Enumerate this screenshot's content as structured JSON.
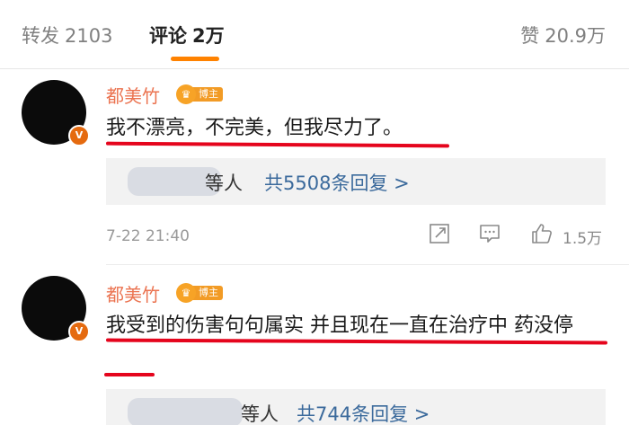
{
  "tabs": {
    "repost_label": "转发",
    "repost_count": "2103",
    "comment_label": "评论",
    "comment_count": "2万",
    "like_label": "赞",
    "like_count": "20.9万"
  },
  "colors": {
    "accent": "#ff8200",
    "username": "#eb7350",
    "link": "#3b6a9c",
    "annotation": "#e5051d"
  },
  "comments": [
    {
      "username": "都美竹",
      "badge_label": "博主",
      "text": "我不漂亮，不完美，但我尽力了。",
      "reply_users_suffix": "等人",
      "reply_count_label": "共5508条回复 >",
      "time": "7-22 21:40",
      "likes": "1.5万",
      "icons": [
        "share-icon",
        "comment-icon",
        "like-icon"
      ]
    },
    {
      "username": "都美竹",
      "badge_label": "博主",
      "text": "我受到的伤害句句属实 并且现在一直在治疗中 药没停",
      "reply_users_suffix": "等人",
      "reply_count_label": "共744条回复 >"
    }
  ]
}
